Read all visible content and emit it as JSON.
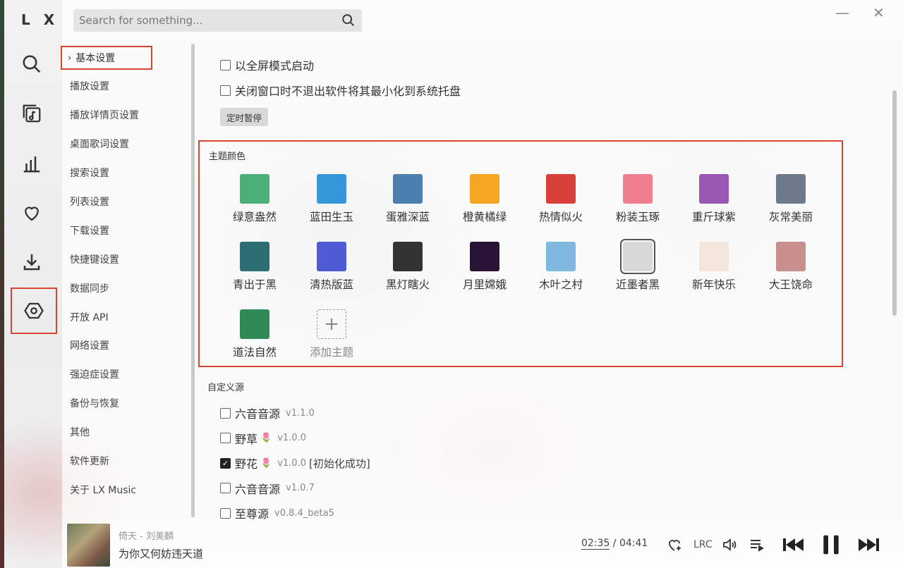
{
  "app": {
    "logo": "L X"
  },
  "search": {
    "placeholder": "Search for something..."
  },
  "window": {
    "minimize_glyph": "—",
    "close_glyph": "✕"
  },
  "nav": {
    "items": [
      {
        "label": "基本设置",
        "active": true
      },
      {
        "label": "播放设置"
      },
      {
        "label": "播放详情页设置"
      },
      {
        "label": "桌面歌词设置"
      },
      {
        "label": "搜索设置"
      },
      {
        "label": "列表设置"
      },
      {
        "label": "下载设置"
      },
      {
        "label": "快捷键设置"
      },
      {
        "label": "数据同步"
      },
      {
        "label": "开放 API"
      },
      {
        "label": "网络设置"
      },
      {
        "label": "强迫症设置"
      },
      {
        "label": "备份与恢复"
      },
      {
        "label": "其他"
      },
      {
        "label": "软件更新"
      },
      {
        "label": "关于 LX Music"
      }
    ]
  },
  "basic": {
    "fullscreen_label": "以全屏模式启动",
    "tray_label": "关闭窗口时不退出软件将其最小化到系统托盘",
    "timer_button": "定时暂停"
  },
  "theme": {
    "title": "主题颜色",
    "items": [
      {
        "label": "绿意盎然",
        "color": "#4caf7a"
      },
      {
        "label": "蓝田生玉",
        "color": "#3498db"
      },
      {
        "label": "蛋雅深蓝",
        "color": "#4a7fb0"
      },
      {
        "label": "橙黄橘绿",
        "color": "#f5a623"
      },
      {
        "label": "热情似火",
        "color": "#d9403a"
      },
      {
        "label": "粉装玉琢",
        "color": "#f08090"
      },
      {
        "label": "重斤球紫",
        "color": "#9b59b6"
      },
      {
        "label": "灰常美丽",
        "color": "#6c7a89"
      },
      {
        "label": "青出于黑",
        "color": "#2c6e74"
      },
      {
        "label": "清热版蓝",
        "color": "#4f5bd5"
      },
      {
        "label": "黑灯瞎火",
        "color": "#333333"
      },
      {
        "label": "月里嫦娥",
        "color": "#2a1436"
      },
      {
        "label": "木叶之村",
        "color": "#7fb8e0"
      },
      {
        "label": "近墨者黑",
        "color": "#d8d8d8",
        "selected": true
      },
      {
        "label": "新年快乐",
        "color": "#f3e6da"
      },
      {
        "label": "大王饶命",
        "color": "#c98f8f"
      },
      {
        "label": "道法自然",
        "color": "#2e8b57"
      }
    ],
    "add_label": "添加主题",
    "add_glyph": "+"
  },
  "sources": {
    "title": "自定义源",
    "items": [
      {
        "name": "六音音源",
        "emoji": "",
        "version": "v1.1.0",
        "checked": false,
        "extra": ""
      },
      {
        "name": "野草",
        "emoji": "🌷",
        "version": "v1.0.0",
        "checked": false,
        "extra": ""
      },
      {
        "name": "野花",
        "emoji": "🌷",
        "version": "v1.0.0",
        "checked": true,
        "extra": "[初始化成功]"
      },
      {
        "name": "六音音源",
        "emoji": "",
        "version": "v1.0.7",
        "checked": false,
        "extra": ""
      },
      {
        "name": "至尊源",
        "emoji": "",
        "version": "v0.8.4_beta5",
        "checked": false,
        "extra": ""
      }
    ]
  },
  "player": {
    "song_top": "倚天 - 刘美麟",
    "song_name": "为你又何妨违天道",
    "current_time": "02:35",
    "separator": " / ",
    "total_time": "04:41",
    "lrc_label": "LRC"
  }
}
